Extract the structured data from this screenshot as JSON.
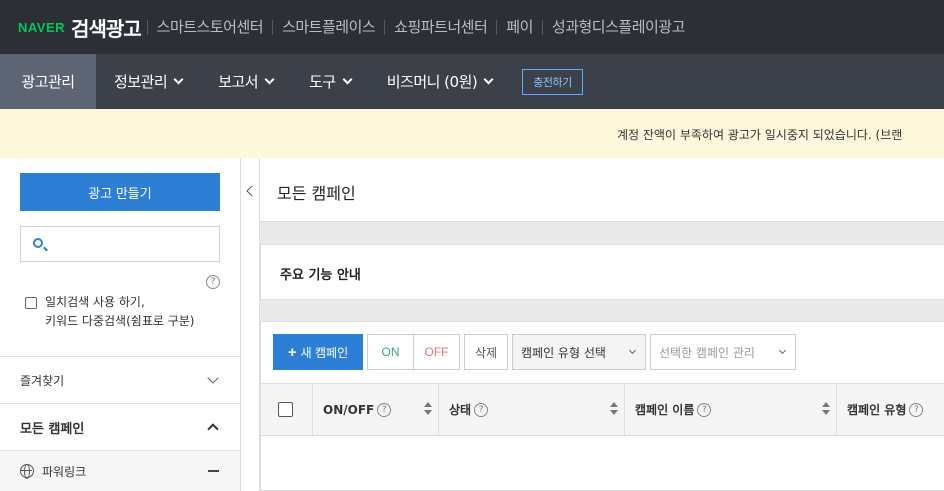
{
  "topbar": {
    "logo": "NAVER",
    "title": "검색광고",
    "links": [
      "스마트스토어센터",
      "스마트플레이스",
      "쇼핑파트너센터",
      "페이",
      "성과형디스플레이광고"
    ]
  },
  "nav": {
    "items": [
      "광고관리",
      "정보관리",
      "보고서",
      "도구",
      "비즈머니 (0원)"
    ],
    "charge_label": "충전하기"
  },
  "notice": {
    "text": "계정 잔액이 부족하여 광고가 일시중지 되었습니다. (브랜"
  },
  "sidebar": {
    "create_label": "광고 만들기",
    "search_placeholder": "",
    "help_icon": "?",
    "exact_match_label_line1": "일치검색 사용 하기,",
    "exact_match_label_line2": "키워드 다중검색(쉼표로 구분)",
    "favorites_label": "즐겨찾기",
    "all_campaigns_label": "모든 캠페인",
    "powerlink_label": "파워링크"
  },
  "main": {
    "page_title": "모든 캠페인",
    "feature_title": "주요 기능 안내",
    "toolbar": {
      "new_label": "새 캠페인",
      "on_label": "ON",
      "off_label": "OFF",
      "delete_label": "삭제",
      "type_select_label": "캠페인 유형 선택",
      "manage_label": "선택한 캠페인 관리"
    },
    "columns": [
      "ON/OFF",
      "상태",
      "캠페인 이름",
      "캠페인 유형"
    ]
  },
  "colors": {
    "topbar_bg": "#2c3036",
    "navbar_bg": "#3c4048",
    "nav_active_bg": "#5d6473",
    "primary": "#2d7fd6",
    "naver_green": "#03c75a",
    "notice_bg": "#fdf8dc"
  }
}
